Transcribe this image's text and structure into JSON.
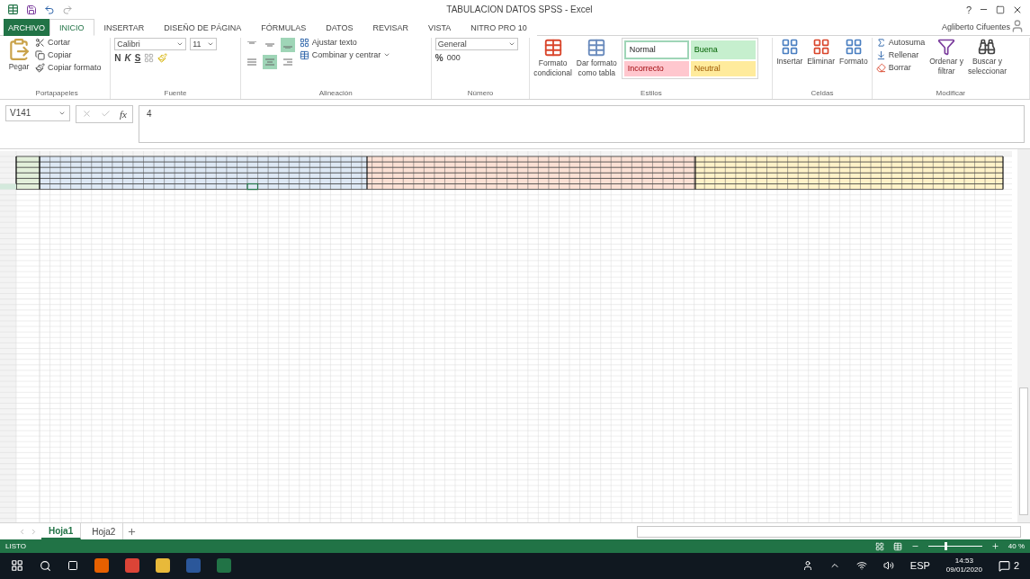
{
  "window": {
    "title": "TABULACION DATOS SPSS - Excel",
    "user": "Agliberto Cifuentes",
    "help": "?"
  },
  "tabs": [
    {
      "label": "ARCHIVO",
      "kind": "file",
      "selected": false
    },
    {
      "label": "INICIO",
      "kind": "tab",
      "selected": true
    },
    {
      "label": "INSERTAR",
      "kind": "tab",
      "selected": false
    },
    {
      "label": "DISEÑO DE PÁGINA",
      "kind": "tab",
      "selected": false
    },
    {
      "label": "FÓRMULAS",
      "kind": "tab",
      "selected": false
    },
    {
      "label": "DATOS",
      "kind": "tab",
      "selected": false
    },
    {
      "label": "REVISAR",
      "kind": "tab",
      "selected": false
    },
    {
      "label": "VISTA",
      "kind": "tab",
      "selected": false
    },
    {
      "label": "NITRO PRO 10",
      "kind": "tab",
      "selected": false
    }
  ],
  "clipboard": {
    "label": "Portapapeles",
    "paste": "Pegar",
    "actions": [
      "Cortar",
      "Copiar",
      "Copiar formato"
    ]
  },
  "font": {
    "label": "Fuente",
    "name": "Calibri",
    "size": "11",
    "styles": [
      "N",
      "K",
      "S"
    ]
  },
  "alignment": {
    "label": "Alineación",
    "vertical": [
      {
        "selected": false
      },
      {
        "selected": false
      },
      {
        "selected": true
      }
    ],
    "horizontal": [
      {
        "selected": false
      },
      {
        "selected": true
      },
      {
        "selected": false
      }
    ],
    "wrap": "Ajustar texto",
    "merge": "Combinar y centrar"
  },
  "number": {
    "label": "Número",
    "format": "General",
    "percent": "%",
    "thousands": "000"
  },
  "styles": {
    "label": "Estilos",
    "commands": [
      [
        "Formato",
        "condicional"
      ],
      [
        "Dar formato",
        "como tabla"
      ]
    ],
    "cell_styles": [
      {
        "label": "Normal",
        "color": "#ffffff"
      },
      {
        "label": "Buena",
        "color": "#c6efce"
      },
      {
        "label": "Incorrecto",
        "color": "#ffc7ce"
      },
      {
        "label": "Neutral",
        "color": "#ffeb9c"
      }
    ]
  },
  "cells": {
    "label": "Celdas",
    "commands": [
      "Insertar",
      "Eliminar",
      "Formato"
    ]
  },
  "editing": {
    "label": "Modificar",
    "actions": [
      "Autosuma",
      "Rellenar",
      "Borrar"
    ],
    "commands": [
      [
        "Ordenar y",
        "filtrar"
      ],
      [
        "Buscar y",
        "seleccionar"
      ]
    ]
  },
  "formula_bar": {
    "name_box": "V141",
    "function_label": "fx",
    "value": "4"
  },
  "sheets": [
    {
      "label": "Hoja1",
      "selected": true
    },
    {
      "label": "Hoja2",
      "selected": false
    }
  ],
  "status_bar": {
    "status": "LISTO",
    "zoom": "40 %",
    "level": 0.3
  },
  "taskbar": {
    "language": "ESP",
    "time": "14:53",
    "date": "09/01/2020",
    "notifications": "2"
  }
}
